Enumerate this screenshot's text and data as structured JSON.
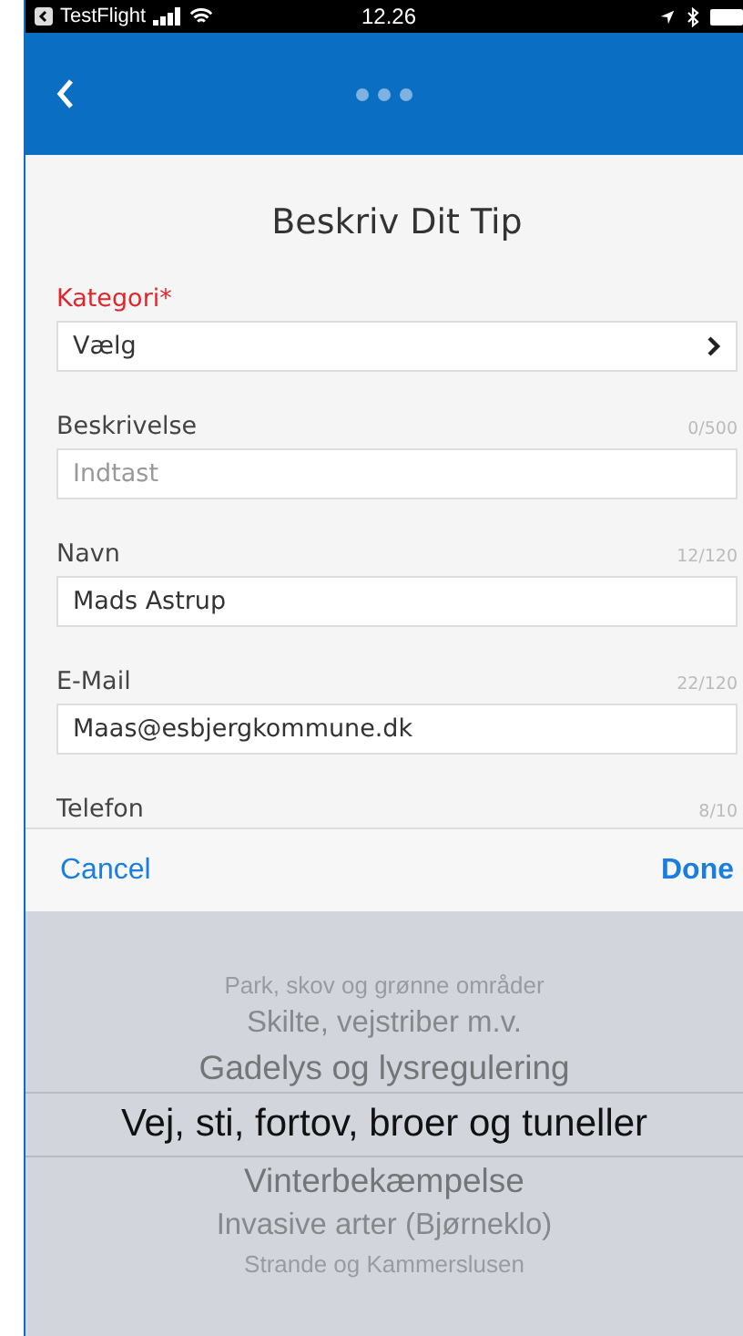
{
  "status_bar": {
    "back_app": "TestFlight",
    "time": "12.26"
  },
  "title": "Beskriv Dit Tip",
  "fields": [
    {
      "kind": "select",
      "label": "Kategori*",
      "required": true,
      "value": "Vælg"
    },
    {
      "kind": "input",
      "label": "Beskrivelse",
      "required": false,
      "counter": "0/500",
      "placeholder": "Indtast"
    },
    {
      "kind": "input",
      "label": "Navn",
      "required": false,
      "counter": "12/120",
      "value": "Mads Astrup"
    },
    {
      "kind": "input",
      "label": "E-Mail",
      "required": false,
      "counter": "22/120",
      "value": "Maas@esbjergkommune.dk"
    },
    {
      "kind": "label",
      "label": "Telefon",
      "required": false,
      "counter": "8/10"
    }
  ],
  "toolbar": {
    "cancel": "Cancel",
    "done": "Done"
  },
  "picker": [
    {
      "label": "Park, skov og grønne områder",
      "selected": false
    },
    {
      "label": "Skilte, vejstriber m.v.",
      "selected": false
    },
    {
      "label": "Gadelys og lysregulering",
      "selected": false
    },
    {
      "label": "Vej, sti, fortov, broer og tuneller",
      "selected": true
    },
    {
      "label": "Vinterbekæmpelse",
      "selected": false
    },
    {
      "label": "Invasive arter (Bjørneklo)",
      "selected": false
    },
    {
      "label": "Strande og Kammerslusen",
      "selected": false
    }
  ]
}
